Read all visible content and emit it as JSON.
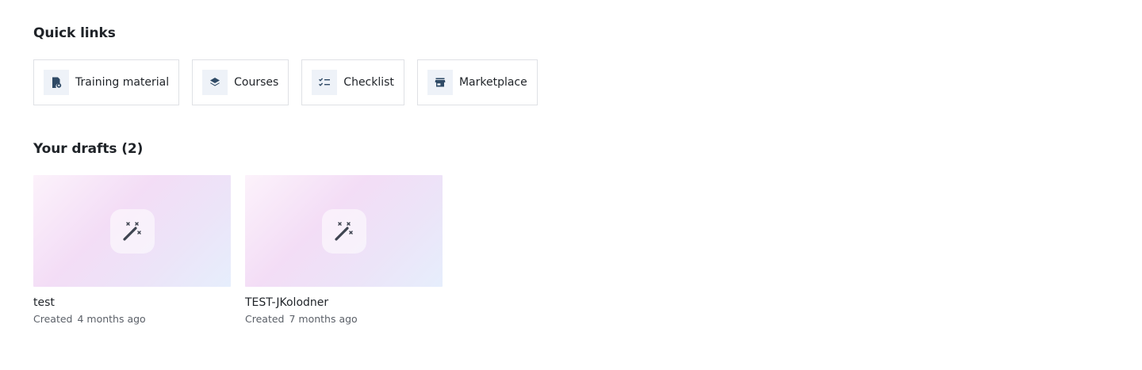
{
  "quick_links": {
    "title": "Quick links",
    "items": [
      {
        "label": "Training material",
        "icon": "training-material-icon"
      },
      {
        "label": "Courses",
        "icon": "layers-icon"
      },
      {
        "label": "Checklist",
        "icon": "checklist-icon"
      },
      {
        "label": "Marketplace",
        "icon": "storefront-icon"
      }
    ]
  },
  "drafts": {
    "title": "Your drafts (2)",
    "items": [
      {
        "title": "test",
        "created_label": "Created",
        "created_ago": "4 months ago",
        "icon": "magic-wand-icon"
      },
      {
        "title": "TEST-JKolodner",
        "created_label": "Created",
        "created_ago": "7 months ago",
        "icon": "magic-wand-icon"
      }
    ]
  },
  "colors": {
    "icon_tile_bg": "#eef2f8",
    "icon_color": "#2f4a66",
    "card_border": "#dfe1e5",
    "text_primary": "#1f2328",
    "text_secondary": "#5b6068",
    "thumb_gradient_start": "#fcf2fb",
    "thumb_gradient_end": "#e6eefc"
  }
}
